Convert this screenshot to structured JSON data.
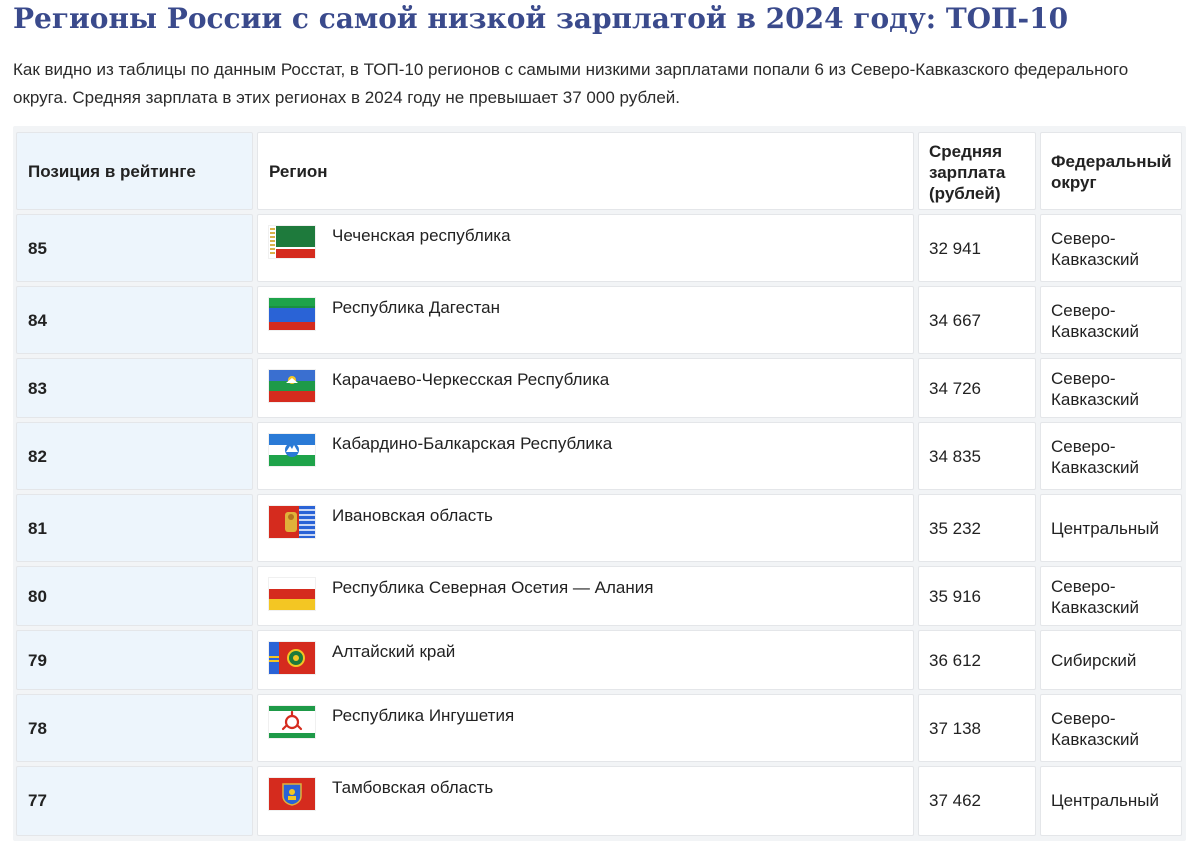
{
  "page": {
    "title": "Регионы России с самой низкой зарплатой в 2024 году: ТОП-10",
    "intro": "Как видно из таблицы по данным Росстат, в ТОП-10 регионов с самыми низкими зарплатами попали 6 из Северо-Кавказского федерального округа. Средняя зарплата в этих регионах в 2024 году не превышает 37 000 рублей."
  },
  "table": {
    "headers": {
      "position": "Позиция в рейтинге",
      "region": "Регион",
      "salary": "Средняя зарплата (рублей)",
      "district": "Федеральный округ"
    },
    "rows": [
      {
        "position": "85",
        "region": "Чеченская республика",
        "flag_icon": "chechnya-flag-icon",
        "salary": "32 941",
        "district": "Северо-Кавказский"
      },
      {
        "position": "84",
        "region": "Республика Дагестан",
        "flag_icon": "dagestan-flag-icon",
        "salary": "34 667",
        "district": "Северо-Кавказский"
      },
      {
        "position": "83",
        "region": "Карачаево-Черкесская Республика",
        "flag_icon": "karachay-cherkessia-flag-icon",
        "salary": "34 726",
        "district": "Северо-Кавказский"
      },
      {
        "position": "82",
        "region": "Кабардино-Балкарская Республика",
        "flag_icon": "kabardino-balkaria-flag-icon",
        "salary": "34 835",
        "district": "Северо-Кавказский"
      },
      {
        "position": "81",
        "region": "Ивановская область",
        "flag_icon": "ivanovo-flag-icon",
        "salary": "35 232",
        "district": "Центральный"
      },
      {
        "position": "80",
        "region": "Республика Северная Осетия — Алания",
        "flag_icon": "north-ossetia-flag-icon",
        "salary": "35 916",
        "district": "Северо-Кавказский"
      },
      {
        "position": "79",
        "region": "Алтайский край",
        "flag_icon": "altai-krai-flag-icon",
        "salary": "36 612",
        "district": "Сибирский"
      },
      {
        "position": "78",
        "region": "Республика Ингушетия",
        "flag_icon": "ingushetia-flag-icon",
        "salary": "37 138",
        "district": "Северо-Кавказский"
      },
      {
        "position": "77",
        "region": "Тамбовская область",
        "flag_icon": "tambov-flag-icon",
        "salary": "37 462",
        "district": "Центральный"
      }
    ]
  },
  "colors": {
    "title": "#3a4a8c",
    "position_cell_bg": "#edf5fc",
    "grid_bg": "#f2f4f6"
  }
}
